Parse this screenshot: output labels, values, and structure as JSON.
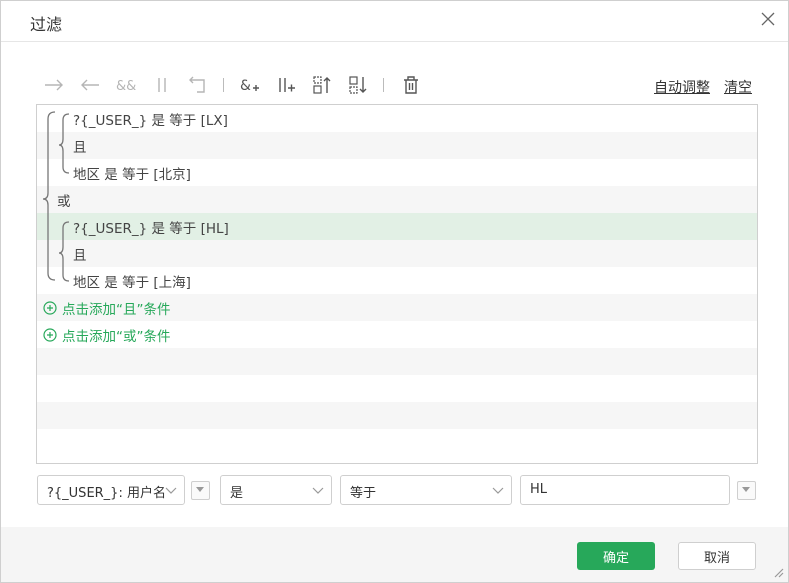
{
  "dialog": {
    "title": "过滤",
    "close_icon": "close-icon"
  },
  "toolbar": {
    "icons": [
      "indent-right-arrow-icon",
      "outdent-left-arrow-icon",
      "and-icon",
      "or-icon",
      "return-arrow-icon",
      "add-and-icon",
      "add-or-icon",
      "move-up-icon",
      "move-down-icon",
      "delete-icon"
    ],
    "auto_adjust": "自动调整",
    "clear": "清空"
  },
  "conditions": [
    {
      "text": "?{_USER_} 是 等于 [LX]"
    },
    {
      "text": "且"
    },
    {
      "text": "地区 是 等于 [北京]"
    },
    {
      "text": "或"
    },
    {
      "text": "?{_USER_} 是 等于 [HL]",
      "selected": true
    },
    {
      "text": "且"
    },
    {
      "text": "地区 是 等于 [上海]"
    }
  ],
  "add_and": "点击添加“且”条件",
  "add_or": "点击添加“或”条件",
  "editor": {
    "field": "?{_USER_}: 用户名",
    "operator": "是",
    "comparison": "等于",
    "value": "HL"
  },
  "footer": {
    "ok": "确定",
    "cancel": "取消"
  },
  "colors": {
    "accent": "#27a85a",
    "selected_row": "#e2f0e5"
  }
}
